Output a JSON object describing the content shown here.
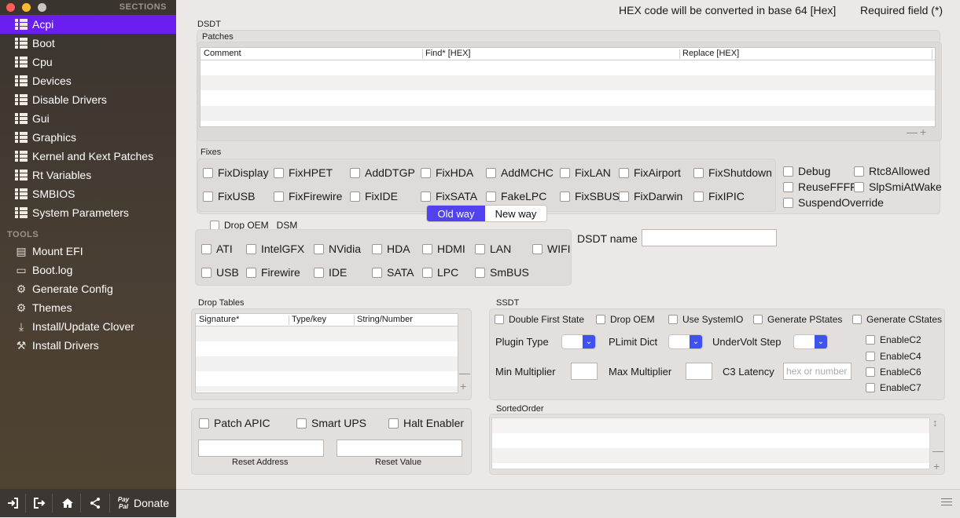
{
  "sidebar": {
    "sections_header": "SECTIONS",
    "tools_header": "TOOLS",
    "sections": [
      {
        "label": "Acpi",
        "icon": "list-icon",
        "selected": true
      },
      {
        "label": "Boot",
        "icon": "list-icon"
      },
      {
        "label": "Cpu",
        "icon": "list-icon"
      },
      {
        "label": "Devices",
        "icon": "list-icon"
      },
      {
        "label": "Disable Drivers",
        "icon": "list-icon"
      },
      {
        "label": "Gui",
        "icon": "list-icon"
      },
      {
        "label": "Graphics",
        "icon": "list-icon"
      },
      {
        "label": "Kernel and Kext Patches",
        "icon": "list-icon"
      },
      {
        "label": "Rt Variables",
        "icon": "list-icon"
      },
      {
        "label": "SMBIOS",
        "icon": "list-icon"
      },
      {
        "label": "System Parameters",
        "icon": "list-icon"
      }
    ],
    "tools": [
      {
        "label": "Mount EFI",
        "icon": "disk-icon"
      },
      {
        "label": "Boot.log",
        "icon": "laptop-icon"
      },
      {
        "label": "Generate Config",
        "icon": "gear-icon"
      },
      {
        "label": "Themes",
        "icon": "palette-icon"
      },
      {
        "label": "Install/Update Clover",
        "icon": "download-icon"
      },
      {
        "label": "Install Drivers",
        "icon": "wrench-icon"
      }
    ],
    "donate_label": "Donate",
    "paypal_label": "Pay Pal"
  },
  "header": {
    "hex_note": "HEX code will be converted in base 64 [Hex]",
    "required_note": "Required field (*)"
  },
  "dsdt": {
    "title": "DSDT",
    "patches_title": "Patches",
    "patch_columns": [
      "Comment",
      "Find* [HEX]",
      "Replace [HEX]"
    ],
    "fixes_title": "Fixes",
    "fixes_row1": [
      "FixDisplay",
      "FixHPET",
      "AddDTGP",
      "FixHDA",
      "AddMCHC",
      "FixLAN",
      "FixAirport",
      "FixShutdown"
    ],
    "fixes_row2": [
      "FixUSB",
      "FixFirewire",
      "FixIDE",
      "FixSATA",
      "FakeLPC",
      "FixSBUS",
      "FixDarwin",
      "FixIPIC"
    ],
    "extra_options": [
      "Debug",
      "Rtc8Allowed",
      "ReuseFFFF",
      "SlpSmiAtWake",
      "SuspendOverride"
    ],
    "old_way": "Old way",
    "new_way": "New way",
    "drop_oem_dsm": "Drop OEM _DSM",
    "dsm_row1": [
      "ATI",
      "IntelGFX",
      "NVidia",
      "HDA",
      "HDMI",
      "LAN",
      "WIFI"
    ],
    "dsm_row2": [
      "USB",
      "Firewire",
      "IDE",
      "SATA",
      "LPC",
      "SmBUS"
    ],
    "dsdt_name_label": "DSDT name",
    "dsdt_name_value": ""
  },
  "drop_tables": {
    "title": "Drop Tables",
    "columns": [
      "Signature*",
      "Type/key",
      "String/Number"
    ]
  },
  "apic": {
    "checks": [
      "Patch APIC",
      "Smart UPS",
      "Halt Enabler"
    ],
    "reset_address_label": "Reset Address",
    "reset_value_label": "Reset Value"
  },
  "ssdt": {
    "title": "SSDT",
    "checks": [
      "Double First State",
      "Drop OEM",
      "Use SystemIO",
      "Generate PStates",
      "Generate CStates"
    ],
    "plugin_type_label": "Plugin Type",
    "plimit_label": "PLimit Dict",
    "undervolt_label": "UnderVolt Step",
    "min_mult_label": "Min Multiplier",
    "max_mult_label": "Max Multiplier",
    "c3_label": "C3 Latency",
    "c3_placeholder": "hex or number",
    "enable_c": [
      "EnableC2",
      "EnableC4",
      "EnableC6",
      "EnableC7"
    ]
  },
  "sorted_order": {
    "title": "SortedOrder"
  }
}
